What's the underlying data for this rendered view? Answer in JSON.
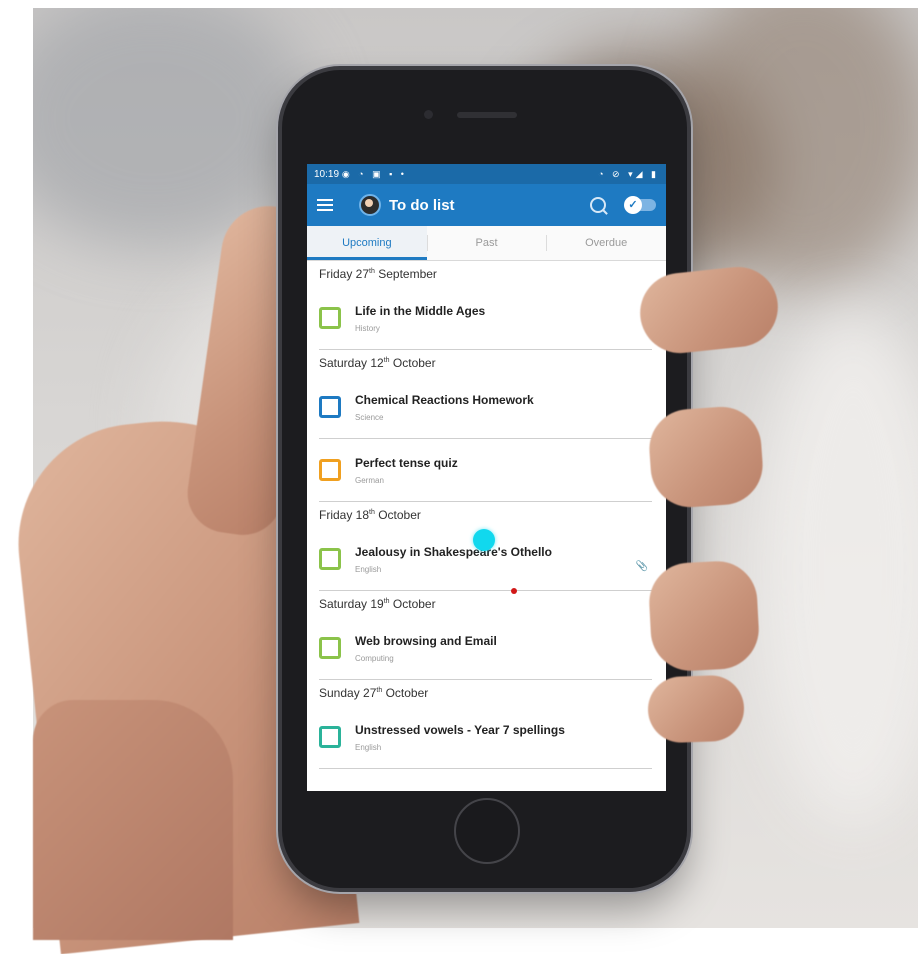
{
  "status_bar": {
    "time": "10:19",
    "left_icons": "◉ ◔ ▣ ▪ •",
    "right_icons": "◔ ⊘ ▾◢ ▮"
  },
  "app_bar": {
    "title": "To do list",
    "toggle_glyph": "✓"
  },
  "tabs": [
    {
      "label": "Upcoming",
      "active": true
    },
    {
      "label": "Past",
      "active": false
    },
    {
      "label": "Overdue",
      "active": false
    }
  ],
  "groups": [
    {
      "day": "Friday 27",
      "suffix": "th",
      "month": "September",
      "items": [
        {
          "title": "Life in the Middle Ages",
          "subject": "History",
          "color": "#8bc34a"
        }
      ]
    },
    {
      "day": "Saturday 12",
      "suffix": "th",
      "month": "October",
      "items": [
        {
          "title": "Chemical Reactions Homework",
          "subject": "Science",
          "color": "#1e7ac2"
        },
        {
          "title": "Perfect tense quiz",
          "subject": "German",
          "color": "#f0a020"
        }
      ]
    },
    {
      "day": "Friday 18",
      "suffix": "th",
      "month": "October",
      "items": [
        {
          "title": "Jealousy in Shakespeare's Othello",
          "subject": "English",
          "color": "#8bc34a",
          "attachment": true
        }
      ]
    },
    {
      "day": "Saturday 19",
      "suffix": "th",
      "month": "October",
      "items": [
        {
          "title": "Web browsing and Email",
          "subject": "Computing",
          "color": "#8bc34a"
        }
      ]
    },
    {
      "day": "Sunday 27",
      "suffix": "th",
      "month": "October",
      "items": [
        {
          "title": "Unstressed vowels - Year 7 spellings",
          "subject": "English",
          "color": "#2bb39a"
        }
      ]
    }
  ]
}
